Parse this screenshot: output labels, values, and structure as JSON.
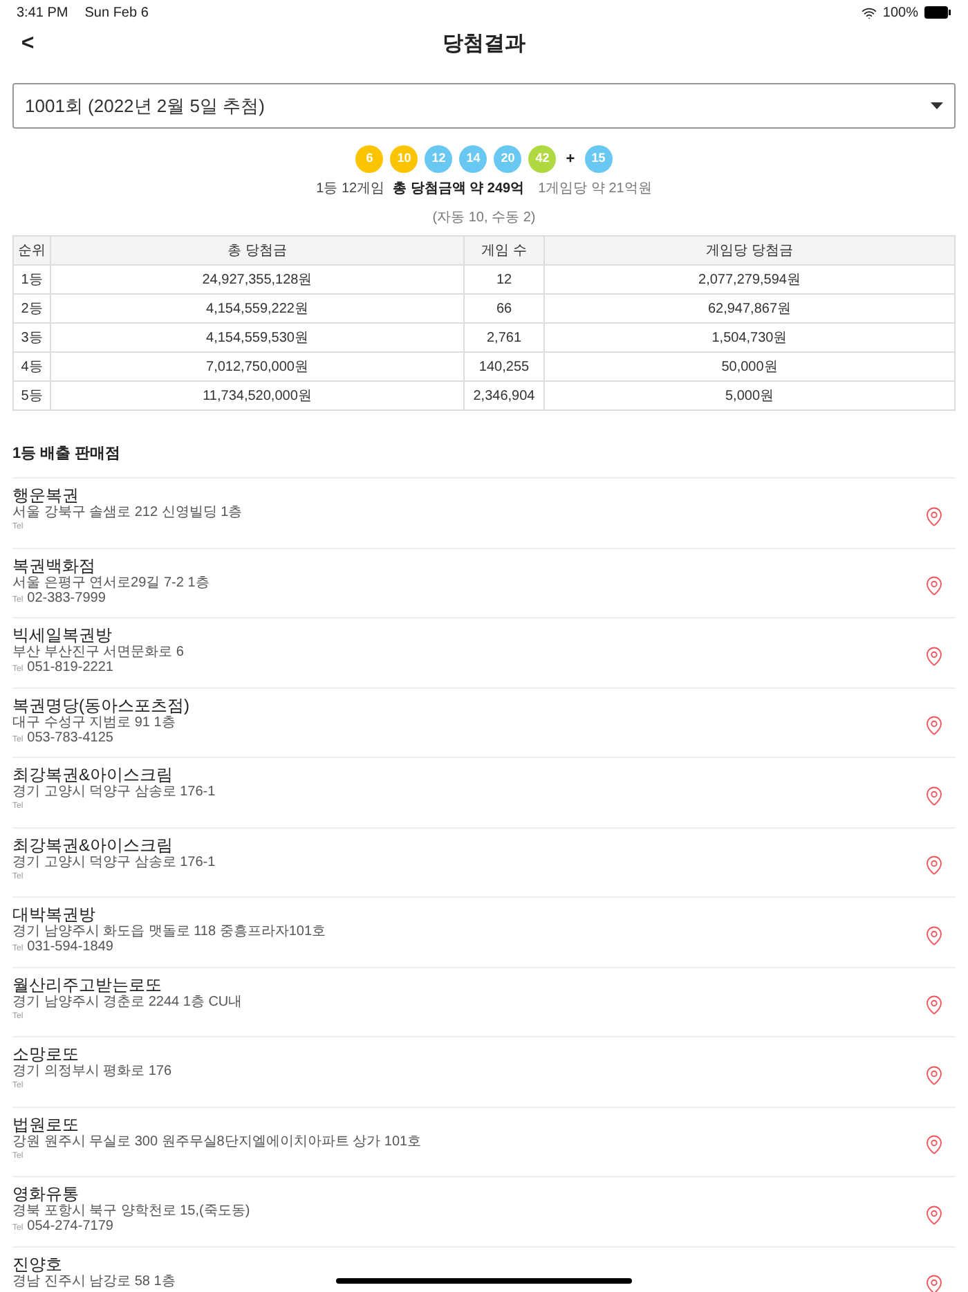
{
  "status_bar": {
    "time": "3:41 PM",
    "date": "Sun Feb 6",
    "battery": "100%"
  },
  "nav": {
    "back": "<",
    "title": "당첨결과"
  },
  "round_select": {
    "value": "1001회 (2022년 2월 5일 추첨)"
  },
  "balls": [
    {
      "number": "6",
      "color": "#fbc400"
    },
    {
      "number": "10",
      "color": "#fbc400"
    },
    {
      "number": "12",
      "color": "#69c8f2"
    },
    {
      "number": "14",
      "color": "#69c8f2"
    },
    {
      "number": "20",
      "color": "#69c8f2"
    },
    {
      "number": "42",
      "color": "#b0d840"
    }
  ],
  "plus": "+",
  "bonus_ball": {
    "number": "15",
    "color": "#69c8f2"
  },
  "summary": {
    "winners": "1등 12게임",
    "total": "총 당첨금액 약 249억",
    "per_game": "1게임당 약 21억원",
    "split": "(자동 10, 수동 2)"
  },
  "table": {
    "columns": [
      "순위",
      "총 당첨금",
      "게임 수",
      "게임당 당첨금"
    ],
    "rows": [
      [
        "1등",
        "24,927,355,128원",
        "12",
        "2,077,279,594원"
      ],
      [
        "2등",
        "4,154,559,222원",
        "66",
        "62,947,867원"
      ],
      [
        "3등",
        "4,154,559,530원",
        "2,761",
        "1,504,730원"
      ],
      [
        "4등",
        "7,012,750,000원",
        "140,255",
        "50,000원"
      ],
      [
        "5등",
        "11,734,520,000원",
        "2,346,904",
        "5,000원"
      ]
    ]
  },
  "stores_title": "1등 배출 판매점",
  "stores": [
    {
      "name": "행운복권",
      "address": "서울 강북구 솔샘로 212 신영빌딩 1층",
      "tel_label": "Tel"
    },
    {
      "name": "복권백화점",
      "address": "서울 은평구 연서로29길 7-2 1층",
      "tel_label": "Tel",
      "phone": "02-383-7999"
    },
    {
      "name": "빅세일복권방",
      "address": "부산 부산진구 서면문화로 6",
      "tel_label": "Tel",
      "phone": "051-819-2221"
    },
    {
      "name": "복권명당(동아스포츠점)",
      "address": "대구 수성구 지범로 91 1층",
      "tel_label": "Tel",
      "phone": "053-783-4125"
    },
    {
      "name": "최강복권&아이스크림",
      "address": "경기 고양시 덕양구 삼송로 176-1",
      "tel_label": "Tel"
    },
    {
      "name": "최강복권&아이스크림",
      "address": "경기 고양시 덕양구 삼송로 176-1",
      "tel_label": "Tel"
    },
    {
      "name": "대박복권방",
      "address": "경기 남양주시 화도읍 맷돌로 118 중흥프라자101호",
      "tel_label": "Tel",
      "phone": "031-594-1849"
    },
    {
      "name": "월산리주고받는로또",
      "address": "경기 남양주시 경춘로 2244 1층 CU내",
      "tel_label": "Tel"
    },
    {
      "name": "소망로또",
      "address": "경기 의정부시 평화로 176",
      "tel_label": "Tel"
    },
    {
      "name": "법원로또",
      "address": "강원 원주시 무실로 300 원주무실8단지엘에이치아파트 상가 101호",
      "tel_label": "Tel"
    },
    {
      "name": "영화유통",
      "address": "경북 포항시 북구 양학천로 15,(죽도동)",
      "tel_label": "Tel",
      "phone": "054-274-7179"
    },
    {
      "name": "진양호",
      "address": "경남 진주시 남강로 58 1층"
    }
  ]
}
